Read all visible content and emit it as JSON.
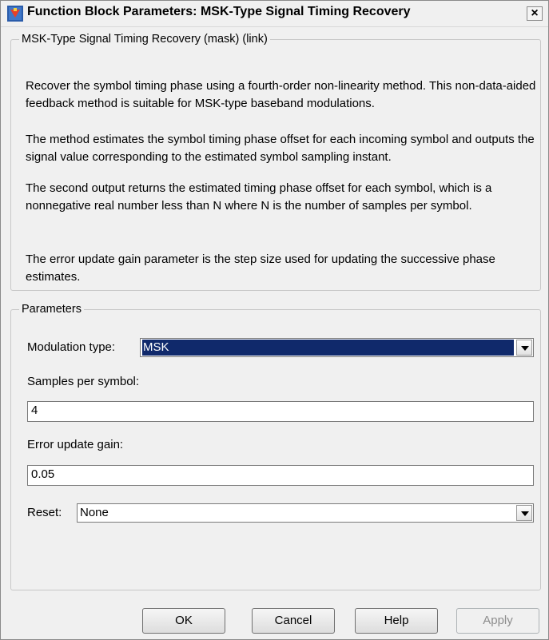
{
  "window": {
    "title": "Function Block Parameters: MSK-Type Signal Timing Recovery",
    "close_symbol": "×"
  },
  "description": {
    "group_title": "MSK-Type Signal Timing Recovery (mask) (link)",
    "paragraphs": [
      "Recover the symbol timing phase using a fourth-order non-linearity method. This non-data-aided feedback method is suitable for MSK-type baseband modulations.",
      "The method estimates the symbol timing phase offset for each incoming symbol and outputs the signal value corresponding to the estimated symbol sampling instant.",
      "The second output returns the estimated timing phase offset for each symbol, which is a nonnegative real number less than N where N is the number of samples per symbol.",
      "The error update gain parameter is the step size used for updating the successive phase estimates."
    ]
  },
  "parameters": {
    "group_title": "Parameters",
    "modulation_type": {
      "label": "Modulation type:",
      "value": "MSK"
    },
    "samples_per_symbol": {
      "label": "Samples per symbol:",
      "value": "4"
    },
    "error_update_gain": {
      "label": "Error update gain:",
      "value": "0.05"
    },
    "reset": {
      "label": "Reset:",
      "value": "None"
    }
  },
  "buttons": {
    "ok": "OK",
    "cancel": "Cancel",
    "help": "Help",
    "apply": "Apply"
  },
  "icons": {
    "app": "simulink-block-icon",
    "close": "close-icon",
    "dropdown": "chevron-down-icon"
  },
  "colors": {
    "selection": "#10296b",
    "window_bg": "#f0f0f0"
  }
}
